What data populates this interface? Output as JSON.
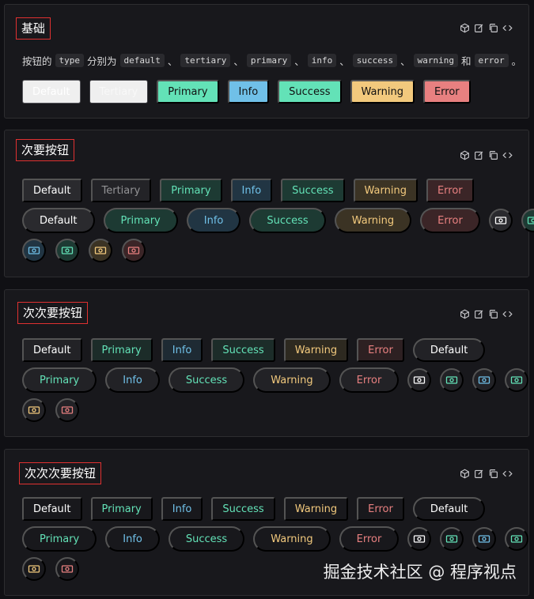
{
  "sections": {
    "basic": {
      "title": "基础",
      "desc": {
        "prefix": "按钮的",
        "code_type": "type",
        "mid": "分别为",
        "codes": [
          "default",
          "tertiary",
          "primary",
          "info",
          "success",
          "warning",
          "error"
        ],
        "separator": "、",
        "and": "和",
        "end": "。"
      },
      "buttons": [
        "Default",
        "Tertiary",
        "Primary",
        "Info",
        "Success",
        "Warning",
        "Error"
      ]
    },
    "secondary": {
      "title": "次要按钮",
      "row1": [
        "Default",
        "Tertiary",
        "Primary",
        "Info",
        "Success",
        "Warning",
        "Error"
      ],
      "row2": [
        "Default",
        "Primary",
        "Info",
        "Success",
        "Warning",
        "Error"
      ]
    },
    "tertiary": {
      "title": "次次要按钮",
      "row1": [
        "Default",
        "Primary",
        "Info",
        "Success",
        "Warning",
        "Error",
        "Default"
      ],
      "row2": [
        "Primary",
        "Info",
        "Success",
        "Warning",
        "Error"
      ]
    },
    "quaternary": {
      "title": "次次次要按钮",
      "row1": [
        "Default",
        "Primary",
        "Info",
        "Success",
        "Warning",
        "Error",
        "Default"
      ],
      "row2": [
        "Primary",
        "Info",
        "Success",
        "Warning",
        "Error"
      ]
    }
  },
  "watermark": "掘金技术社区 @ 程序视点",
  "colors": {
    "primary": "#63e2b7",
    "info": "#70c0e8",
    "success": "#63e2b7",
    "warning": "#f2c97d",
    "error": "#e88080",
    "title_border": "#e03131"
  },
  "icons": {
    "card_tools": [
      "cube-icon",
      "edit-icon",
      "copy-icon",
      "code-icon"
    ],
    "button_icon": "cash-icon"
  }
}
